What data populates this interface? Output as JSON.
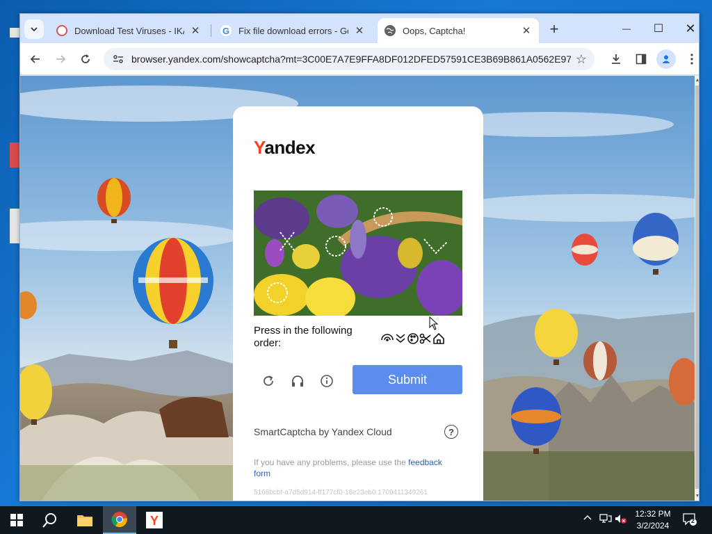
{
  "browser": {
    "tabs": [
      {
        "title": "Download Test Viruses - IKARUS",
        "favicon": "ikarus-icon",
        "active": false
      },
      {
        "title": "Fix file download errors - Google",
        "favicon": "google-icon",
        "active": false
      },
      {
        "title": "Oops, Captcha!",
        "favicon": "globe-icon",
        "active": true
      }
    ],
    "new_tab": "+",
    "url": "browser.yandex.com/showcaptcha?mt=3C00E7A7E9FFA8DF012DFED57591CE3B69B861A0562E97E94...",
    "controls": {
      "minimize": "—",
      "maximize": "☐",
      "close": "✕"
    }
  },
  "captcha": {
    "logo_y": "Y",
    "logo_rest": "andex",
    "instruction": "Press in the following order:",
    "submit_label": "Submit",
    "brand": "SmartCaptcha by Yandex Cloud",
    "help": "?",
    "problems_text": "If you have any problems, please use the ",
    "problems_link": "feedback form",
    "id": "5168bcbf-a7d5d914-ff177cf0-18e23eb0:1709411349261",
    "order_icons": [
      "wifi-icon",
      "chevrons-down-icon",
      "palette-icon",
      "scissors-icon",
      "home-icon"
    ],
    "colors": {
      "accent": "#5b8def",
      "logo_red": "#fc3f1d"
    }
  },
  "taskbar": {
    "time": "12:32 PM",
    "date": "3/2/2024",
    "notifications": "2"
  }
}
